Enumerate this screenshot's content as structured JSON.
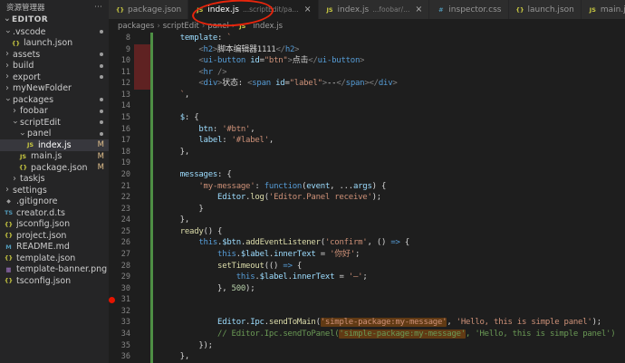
{
  "colors": {
    "annotation": "#e8250c",
    "git_modified_strip": "#4e8f44",
    "git_deleted_block": "#5f2222",
    "occurrence_highlight": "#613a14",
    "breakpoint": "#e51400",
    "modified_badge": "#e2c08d"
  },
  "icons": {
    "js": "JS",
    "json": "{}",
    "css": "#",
    "ts": "TS",
    "md": "M",
    "img": "▦",
    "git": "◆",
    "chev": "›"
  },
  "sidebar": {
    "title": "资源管理器",
    "more_icon": "⋯",
    "section": "EDITOR",
    "items": [
      {
        "label": ".vscode",
        "level": 0,
        "kind": "folder",
        "expanded": true,
        "dot": true
      },
      {
        "label": "launch.json",
        "level": 1,
        "kind": "file",
        "icon": "json"
      },
      {
        "label": "assets",
        "level": 0,
        "kind": "folder",
        "expanded": false,
        "dot": true
      },
      {
        "label": "build",
        "level": 0,
        "kind": "folder",
        "expanded": false,
        "dot": true
      },
      {
        "label": "export",
        "level": 0,
        "kind": "folder",
        "expanded": false,
        "dot": true
      },
      {
        "label": "myNewFolder",
        "level": 0,
        "kind": "folder",
        "expanded": false
      },
      {
        "label": "packages",
        "level": 0,
        "kind": "folder",
        "expanded": true,
        "dot": true
      },
      {
        "label": "foobar",
        "level": 1,
        "kind": "folder",
        "expanded": false,
        "dot": true
      },
      {
        "label": "scriptEdit",
        "level": 1,
        "kind": "folder",
        "expanded": true,
        "dot": true
      },
      {
        "label": "panel",
        "level": 2,
        "kind": "folder",
        "expanded": true,
        "dot": true
      },
      {
        "label": "index.js",
        "level": 3,
        "kind": "file",
        "icon": "js",
        "badge": "M",
        "selected": true
      },
      {
        "label": "main.js",
        "level": 2,
        "kind": "file",
        "icon": "js",
        "badge": "M"
      },
      {
        "label": "package.json",
        "level": 2,
        "kind": "file",
        "icon": "json",
        "badge": "M"
      },
      {
        "label": "taskjs",
        "level": 1,
        "kind": "folder",
        "expanded": false
      },
      {
        "label": "settings",
        "level": 0,
        "kind": "folder",
        "expanded": false
      },
      {
        "label": ".gitignore",
        "level": 0,
        "kind": "file",
        "icon": "git"
      },
      {
        "label": "creator.d.ts",
        "level": 0,
        "kind": "file",
        "icon": "ts"
      },
      {
        "label": "jsconfig.json",
        "level": 0,
        "kind": "file",
        "icon": "json"
      },
      {
        "label": "project.json",
        "level": 0,
        "kind": "file",
        "icon": "json"
      },
      {
        "label": "README.md",
        "level": 0,
        "kind": "file",
        "icon": "md"
      },
      {
        "label": "template.json",
        "level": 0,
        "kind": "file",
        "icon": "json"
      },
      {
        "label": "template-banner.png",
        "level": 0,
        "kind": "file",
        "icon": "img"
      },
      {
        "label": "tsconfig.json",
        "level": 0,
        "kind": "file",
        "icon": "json"
      }
    ]
  },
  "tabs": [
    {
      "icon": "json",
      "label": "package.json",
      "active": false,
      "close": false
    },
    {
      "icon": "js",
      "label": "index.js",
      "desc": "...scriptEdit/pa...",
      "active": true,
      "close": true
    },
    {
      "icon": "js",
      "label": "index.js",
      "desc": "...foobar/...",
      "active": false,
      "close": true
    },
    {
      "icon": "css",
      "label": "inspector.css",
      "active": false,
      "close": false
    },
    {
      "icon": "json",
      "label": "launch.json",
      "active": false,
      "close": false
    },
    {
      "icon": "js",
      "label": "main.js",
      "active": false,
      "close": false
    }
  ],
  "breadcrumb": {
    "items": [
      "packages",
      "scriptEdit",
      "panel"
    ],
    "file": "index.js",
    "file_icon": "js",
    "separator": "›"
  },
  "editor": {
    "breakpoint_lines": [
      31
    ],
    "deleted_range": [
      9,
      12
    ],
    "lines": [
      {
        "n": 8,
        "s": [
          [
            "w",
            "    "
          ],
          [
            "p",
            "template"
          ],
          [
            "w",
            ": "
          ],
          [
            "s",
            "`"
          ]
        ]
      },
      {
        "n": 9,
        "s": [
          [
            "w",
            "        "
          ],
          [
            "g",
            "<"
          ],
          [
            "t",
            "h2"
          ],
          [
            "g",
            ">"
          ],
          [
            "w",
            "脚本编辑器1111"
          ],
          [
            "g",
            "</"
          ],
          [
            "t",
            "h2"
          ],
          [
            "g",
            ">"
          ]
        ]
      },
      {
        "n": 10,
        "s": [
          [
            "w",
            "        "
          ],
          [
            "g",
            "<"
          ],
          [
            "t",
            "ui-button"
          ],
          [
            "w",
            " "
          ],
          [
            "a",
            "id"
          ],
          [
            "w",
            "="
          ],
          [
            "s",
            "\"btn\""
          ],
          [
            "g",
            ">"
          ],
          [
            "w",
            "点击"
          ],
          [
            "g",
            "</"
          ],
          [
            "t",
            "ui-button"
          ],
          [
            "g",
            ">"
          ]
        ]
      },
      {
        "n": 11,
        "s": [
          [
            "w",
            "        "
          ],
          [
            "g",
            "<"
          ],
          [
            "t",
            "hr"
          ],
          [
            "w",
            " "
          ],
          [
            "g",
            "/>"
          ]
        ]
      },
      {
        "n": 12,
        "s": [
          [
            "w",
            "        "
          ],
          [
            "g",
            "<"
          ],
          [
            "t",
            "div"
          ],
          [
            "g",
            ">"
          ],
          [
            "w",
            "状态: "
          ],
          [
            "g",
            "<"
          ],
          [
            "t",
            "span"
          ],
          [
            "w",
            " "
          ],
          [
            "a",
            "id"
          ],
          [
            "w",
            "="
          ],
          [
            "s",
            "\"label\""
          ],
          [
            "g",
            ">"
          ],
          [
            "w",
            "--"
          ],
          [
            "g",
            "</"
          ],
          [
            "t",
            "span"
          ],
          [
            "g",
            ">"
          ],
          [
            "g",
            "</"
          ],
          [
            "t",
            "div"
          ],
          [
            "g",
            ">"
          ]
        ]
      },
      {
        "n": 13,
        "s": [
          [
            "w",
            "    "
          ],
          [
            "s",
            "`"
          ],
          [
            "w",
            ","
          ]
        ]
      },
      {
        "n": 14,
        "s": []
      },
      {
        "n": 15,
        "s": [
          [
            "w",
            "    "
          ],
          [
            "p",
            "$"
          ],
          [
            "w",
            ": {"
          ]
        ]
      },
      {
        "n": 16,
        "s": [
          [
            "w",
            "        "
          ],
          [
            "p",
            "btn"
          ],
          [
            "w",
            ": "
          ],
          [
            "s",
            "'#btn'"
          ],
          [
            "w",
            ","
          ]
        ]
      },
      {
        "n": 17,
        "s": [
          [
            "w",
            "        "
          ],
          [
            "p",
            "label"
          ],
          [
            "w",
            ": "
          ],
          [
            "s",
            "'#label'"
          ],
          [
            "w",
            ","
          ]
        ]
      },
      {
        "n": 18,
        "s": [
          [
            "w",
            "    },"
          ]
        ]
      },
      {
        "n": 19,
        "s": []
      },
      {
        "n": 20,
        "s": [
          [
            "w",
            "    "
          ],
          [
            "p",
            "messages"
          ],
          [
            "w",
            ": {"
          ]
        ]
      },
      {
        "n": 21,
        "s": [
          [
            "w",
            "        "
          ],
          [
            "s",
            "'my-message'"
          ],
          [
            "w",
            ": "
          ],
          [
            "k",
            "function"
          ],
          [
            "w",
            "("
          ],
          [
            "a",
            "event"
          ],
          [
            "w",
            ", ..."
          ],
          [
            "a",
            "args"
          ],
          [
            "w",
            ") {"
          ]
        ]
      },
      {
        "n": 22,
        "s": [
          [
            "w",
            "            "
          ],
          [
            "p",
            "Editor"
          ],
          [
            "w",
            "."
          ],
          [
            "f",
            "log"
          ],
          [
            "w",
            "("
          ],
          [
            "s",
            "'Editor.Panel receive'"
          ],
          [
            "w",
            ");"
          ]
        ]
      },
      {
        "n": 23,
        "s": [
          [
            "w",
            "        }"
          ]
        ]
      },
      {
        "n": 24,
        "s": [
          [
            "w",
            "    },"
          ]
        ]
      },
      {
        "n": 25,
        "s": [
          [
            "w",
            "    "
          ],
          [
            "f",
            "ready"
          ],
          [
            "w",
            "() {"
          ]
        ]
      },
      {
        "n": 26,
        "s": [
          [
            "w",
            "        "
          ],
          [
            "k",
            "this"
          ],
          [
            "w",
            "."
          ],
          [
            "p",
            "$btn"
          ],
          [
            "w",
            "."
          ],
          [
            "f",
            "addEventListener"
          ],
          [
            "w",
            "("
          ],
          [
            "s",
            "'confirm'"
          ],
          [
            "w",
            ", () "
          ],
          [
            "k",
            "=>"
          ],
          [
            "w",
            " {"
          ]
        ]
      },
      {
        "n": 27,
        "s": [
          [
            "w",
            "            "
          ],
          [
            "k",
            "this"
          ],
          [
            "w",
            "."
          ],
          [
            "p",
            "$label"
          ],
          [
            "w",
            "."
          ],
          [
            "p",
            "innerText"
          ],
          [
            "w",
            " = "
          ],
          [
            "s",
            "'你好'"
          ],
          [
            "w",
            ";"
          ]
        ]
      },
      {
        "n": 28,
        "s": [
          [
            "w",
            "            "
          ],
          [
            "f",
            "setTimeout"
          ],
          [
            "w",
            "(() "
          ],
          [
            "k",
            "=>"
          ],
          [
            "w",
            " {"
          ]
        ]
      },
      {
        "n": 29,
        "s": [
          [
            "w",
            "                "
          ],
          [
            "k",
            "this"
          ],
          [
            "w",
            "."
          ],
          [
            "p",
            "$label"
          ],
          [
            "w",
            "."
          ],
          [
            "p",
            "innerText"
          ],
          [
            "w",
            " = "
          ],
          [
            "s",
            "'—'"
          ],
          [
            "w",
            ";"
          ]
        ]
      },
      {
        "n": 30,
        "s": [
          [
            "w",
            "            }, "
          ],
          [
            "num",
            "500"
          ],
          [
            "w",
            ");"
          ]
        ]
      },
      {
        "n": 31,
        "s": []
      },
      {
        "n": 32,
        "s": []
      },
      {
        "n": 33,
        "s": [
          [
            "w",
            "            "
          ],
          [
            "p",
            "Editor"
          ],
          [
            "w",
            "."
          ],
          [
            "p",
            "Ipc"
          ],
          [
            "w",
            "."
          ],
          [
            "f",
            "sendToMain"
          ],
          [
            "w",
            "("
          ],
          [
            "shl",
            "'simple-package:my-message'"
          ],
          [
            "w",
            ", "
          ],
          [
            "s",
            "'Hello, this is simple panel'"
          ],
          [
            "w",
            ");"
          ]
        ]
      },
      {
        "n": 34,
        "s": [
          [
            "w",
            "            "
          ],
          [
            "c",
            "// Editor.Ipc.sendToPanel("
          ],
          [
            "chl",
            "'simple-package:my-message'"
          ],
          [
            "c",
            ", 'Hello, this is simple panel')"
          ]
        ]
      },
      {
        "n": 35,
        "s": [
          [
            "w",
            "        });"
          ]
        ]
      },
      {
        "n": 36,
        "s": [
          [
            "w",
            "    },"
          ]
        ]
      }
    ]
  }
}
